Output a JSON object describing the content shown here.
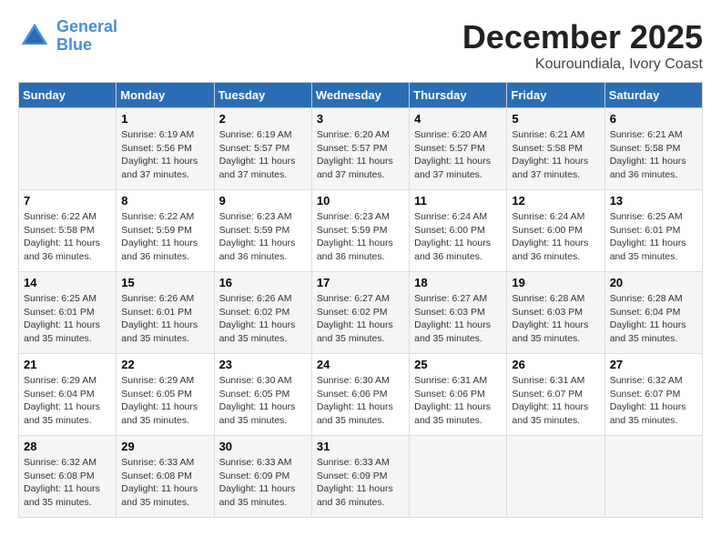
{
  "logo": {
    "line1": "General",
    "line2": "Blue"
  },
  "title": "December 2025",
  "location": "Kouroundiala, Ivory Coast",
  "weekdays": [
    "Sunday",
    "Monday",
    "Tuesday",
    "Wednesday",
    "Thursday",
    "Friday",
    "Saturday"
  ],
  "weeks": [
    [
      {
        "day": null,
        "info": null
      },
      {
        "day": "1",
        "sunrise": "6:19 AM",
        "sunset": "5:56 PM",
        "daylight": "11 hours and 37 minutes."
      },
      {
        "day": "2",
        "sunrise": "6:19 AM",
        "sunset": "5:57 PM",
        "daylight": "11 hours and 37 minutes."
      },
      {
        "day": "3",
        "sunrise": "6:20 AM",
        "sunset": "5:57 PM",
        "daylight": "11 hours and 37 minutes."
      },
      {
        "day": "4",
        "sunrise": "6:20 AM",
        "sunset": "5:57 PM",
        "daylight": "11 hours and 37 minutes."
      },
      {
        "day": "5",
        "sunrise": "6:21 AM",
        "sunset": "5:58 PM",
        "daylight": "11 hours and 37 minutes."
      },
      {
        "day": "6",
        "sunrise": "6:21 AM",
        "sunset": "5:58 PM",
        "daylight": "11 hours and 36 minutes."
      }
    ],
    [
      {
        "day": "7",
        "sunrise": "6:22 AM",
        "sunset": "5:58 PM",
        "daylight": "11 hours and 36 minutes."
      },
      {
        "day": "8",
        "sunrise": "6:22 AM",
        "sunset": "5:59 PM",
        "daylight": "11 hours and 36 minutes."
      },
      {
        "day": "9",
        "sunrise": "6:23 AM",
        "sunset": "5:59 PM",
        "daylight": "11 hours and 36 minutes."
      },
      {
        "day": "10",
        "sunrise": "6:23 AM",
        "sunset": "5:59 PM",
        "daylight": "11 hours and 36 minutes."
      },
      {
        "day": "11",
        "sunrise": "6:24 AM",
        "sunset": "6:00 PM",
        "daylight": "11 hours and 36 minutes."
      },
      {
        "day": "12",
        "sunrise": "6:24 AM",
        "sunset": "6:00 PM",
        "daylight": "11 hours and 36 minutes."
      },
      {
        "day": "13",
        "sunrise": "6:25 AM",
        "sunset": "6:01 PM",
        "daylight": "11 hours and 35 minutes."
      }
    ],
    [
      {
        "day": "14",
        "sunrise": "6:25 AM",
        "sunset": "6:01 PM",
        "daylight": "11 hours and 35 minutes."
      },
      {
        "day": "15",
        "sunrise": "6:26 AM",
        "sunset": "6:01 PM",
        "daylight": "11 hours and 35 minutes."
      },
      {
        "day": "16",
        "sunrise": "6:26 AM",
        "sunset": "6:02 PM",
        "daylight": "11 hours and 35 minutes."
      },
      {
        "day": "17",
        "sunrise": "6:27 AM",
        "sunset": "6:02 PM",
        "daylight": "11 hours and 35 minutes."
      },
      {
        "day": "18",
        "sunrise": "6:27 AM",
        "sunset": "6:03 PM",
        "daylight": "11 hours and 35 minutes."
      },
      {
        "day": "19",
        "sunrise": "6:28 AM",
        "sunset": "6:03 PM",
        "daylight": "11 hours and 35 minutes."
      },
      {
        "day": "20",
        "sunrise": "6:28 AM",
        "sunset": "6:04 PM",
        "daylight": "11 hours and 35 minutes."
      }
    ],
    [
      {
        "day": "21",
        "sunrise": "6:29 AM",
        "sunset": "6:04 PM",
        "daylight": "11 hours and 35 minutes."
      },
      {
        "day": "22",
        "sunrise": "6:29 AM",
        "sunset": "6:05 PM",
        "daylight": "11 hours and 35 minutes."
      },
      {
        "day": "23",
        "sunrise": "6:30 AM",
        "sunset": "6:05 PM",
        "daylight": "11 hours and 35 minutes."
      },
      {
        "day": "24",
        "sunrise": "6:30 AM",
        "sunset": "6:06 PM",
        "daylight": "11 hours and 35 minutes."
      },
      {
        "day": "25",
        "sunrise": "6:31 AM",
        "sunset": "6:06 PM",
        "daylight": "11 hours and 35 minutes."
      },
      {
        "day": "26",
        "sunrise": "6:31 AM",
        "sunset": "6:07 PM",
        "daylight": "11 hours and 35 minutes."
      },
      {
        "day": "27",
        "sunrise": "6:32 AM",
        "sunset": "6:07 PM",
        "daylight": "11 hours and 35 minutes."
      }
    ],
    [
      {
        "day": "28",
        "sunrise": "6:32 AM",
        "sunset": "6:08 PM",
        "daylight": "11 hours and 35 minutes."
      },
      {
        "day": "29",
        "sunrise": "6:33 AM",
        "sunset": "6:08 PM",
        "daylight": "11 hours and 35 minutes."
      },
      {
        "day": "30",
        "sunrise": "6:33 AM",
        "sunset": "6:09 PM",
        "daylight": "11 hours and 35 minutes."
      },
      {
        "day": "31",
        "sunrise": "6:33 AM",
        "sunset": "6:09 PM",
        "daylight": "11 hours and 36 minutes."
      },
      {
        "day": null,
        "info": null
      },
      {
        "day": null,
        "info": null
      },
      {
        "day": null,
        "info": null
      }
    ]
  ],
  "labels": {
    "sunrise_prefix": "Sunrise: ",
    "sunset_prefix": "Sunset: ",
    "daylight_prefix": "Daylight: "
  }
}
